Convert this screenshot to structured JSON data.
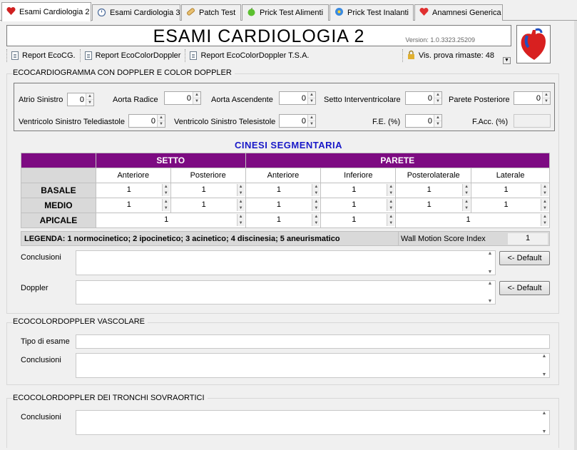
{
  "tabs": [
    {
      "label": "Esami Cardiologia 2",
      "icon": "heart-icon",
      "active": true
    },
    {
      "label": "Esami Cardiologia 3",
      "icon": "stopwatch-icon"
    },
    {
      "label": "Patch Test",
      "icon": "patch-icon"
    },
    {
      "label": "Prick Test Alimenti",
      "icon": "apple-icon"
    },
    {
      "label": "Prick Test Inalanti",
      "icon": "flower-icon"
    },
    {
      "label": "Anamnesi Generica",
      "icon": "heart-icon"
    }
  ],
  "header": {
    "title": "ESAMI CARDIOLOGIA 2",
    "version": "Version: 1.0.3323.25209"
  },
  "toolbar": {
    "items": [
      "Report EcoCG.",
      "Report EcoColorDoppler",
      "Report EcoColorDoppler T.S.A."
    ],
    "trial": "Vis. prova rimaste: 48"
  },
  "eco": {
    "title": "ECOCARDIOGRAMMA CON DOPPLER E COLOR DOPPLER",
    "fields": {
      "atrio": {
        "label": "Atrio Sinistro",
        "value": "0"
      },
      "aorta_radice": {
        "label": "Aorta Radice",
        "value": "0"
      },
      "aorta_asc": {
        "label": "Aorta Ascendente",
        "value": "0"
      },
      "setto": {
        "label": "Setto Interventricolare",
        "value": "0"
      },
      "parete": {
        "label": "Parete Posteriore",
        "value": "0"
      },
      "vst": {
        "label": "Ventricolo Sinistro Telediastole",
        "value": "0"
      },
      "vss": {
        "label": "Ventricolo Sinistro Telesistole",
        "value": "0"
      },
      "fe": {
        "label": "F.E. (%)",
        "value": "0"
      },
      "facc": {
        "label": "F.Acc. (%)",
        "value": ""
      }
    },
    "cinesi": {
      "title": "CINESI  SEGMENTARIA",
      "setto": "SETTO",
      "parete": "PARETE",
      "cols": [
        "Anteriore",
        "Posteriore",
        "Anteriore",
        "Inferiore",
        "Posterolaterale",
        "Laterale"
      ],
      "rows": {
        "basale": {
          "label": "BASALE",
          "values": [
            "1",
            "1",
            "1",
            "1",
            "1",
            "1"
          ]
        },
        "medio": {
          "label": "MEDIO",
          "values": [
            "1",
            "1",
            "1",
            "1",
            "1",
            "1"
          ]
        },
        "apicale": {
          "label": "APICALE",
          "values": [
            "1",
            "1",
            "1",
            "1"
          ]
        }
      },
      "legend": "LEGENDA: 1 normocinetico; 2 ipocinetico; 3 acinetico; 4 discinesia; 5 aneurismatico",
      "wms_label": "Wall Motion Score Index",
      "wms_value": "1"
    },
    "conclusioni_label": "Conclusioni",
    "doppler_label": "Doppler",
    "default_btn": "<- Default"
  },
  "vasc": {
    "title": "ECOCOLORDOPPLER  VASCOLARE",
    "tipo_label": "Tipo di esame",
    "concl_label": "Conclusioni"
  },
  "tsa": {
    "title": "ECOCOLORDOPPLER  DEI TRONCHI SOVRAORTICI",
    "concl_label": "Conclusioni"
  }
}
